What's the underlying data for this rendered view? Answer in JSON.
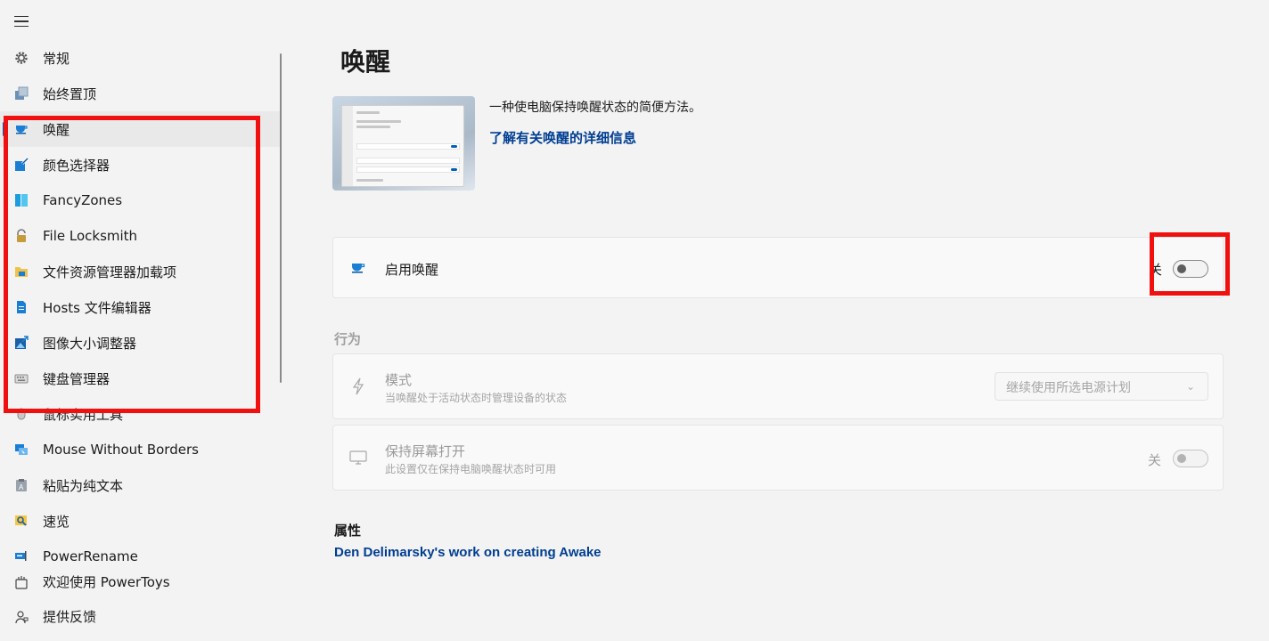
{
  "sidebar": {
    "items": [
      {
        "label": "常规",
        "icon": "gear-icon",
        "selected": false
      },
      {
        "label": "始终置顶",
        "icon": "always-on-top-icon",
        "selected": false
      },
      {
        "label": "唤醒",
        "icon": "coffee-cup-icon",
        "selected": true
      },
      {
        "label": "颜色选择器",
        "icon": "color-picker-icon",
        "selected": false
      },
      {
        "label": "FancyZones",
        "icon": "fancyzones-icon",
        "selected": false
      },
      {
        "label": "File Locksmith",
        "icon": "lock-icon",
        "selected": false
      },
      {
        "label": "文件资源管理器加载项",
        "icon": "folder-icon",
        "selected": false
      },
      {
        "label": "Hosts 文件编辑器",
        "icon": "document-icon",
        "selected": false
      },
      {
        "label": "图像大小调整器",
        "icon": "image-resize-icon",
        "selected": false
      },
      {
        "label": "键盘管理器",
        "icon": "keyboard-icon",
        "selected": false
      },
      {
        "label": "鼠标实用工具",
        "icon": "mouse-icon",
        "selected": false
      },
      {
        "label": "Mouse Without Borders",
        "icon": "mouse-without-borders-icon",
        "selected": false
      },
      {
        "label": "粘贴为纯文本",
        "icon": "paste-text-icon",
        "selected": false
      },
      {
        "label": "速览",
        "icon": "peek-icon",
        "selected": false
      },
      {
        "label": "PowerRename",
        "icon": "rename-icon",
        "selected": false
      }
    ],
    "bottom_items": [
      {
        "label": "欢迎使用 PowerToys",
        "icon": "welcome-icon"
      },
      {
        "label": "提供反馈",
        "icon": "feedback-icon"
      }
    ]
  },
  "main": {
    "title": "唤醒",
    "description": "一种使电脑保持唤醒状态的简便方法。",
    "learn_more_link": "了解有关唤醒的详细信息",
    "enable_card": {
      "label": "启用唤醒",
      "toggle_state": "关",
      "enabled": false
    },
    "behavior_header": "行为",
    "mode_card": {
      "title": "模式",
      "subtitle": "当唤醒处于活动状态时管理设备的状态",
      "selected_value": "继续使用所选电源计划"
    },
    "screen_card": {
      "title": "保持屏幕打开",
      "subtitle": "此设置仅在保持电脑唤醒状态时可用",
      "toggle_state": "关"
    },
    "attribution_header": "属性",
    "attribution_link": "Den Delimarsky's work on creating Awake"
  },
  "colors": {
    "accent": "#005fb8",
    "link": "#003e92",
    "highlight": "#f01010"
  }
}
